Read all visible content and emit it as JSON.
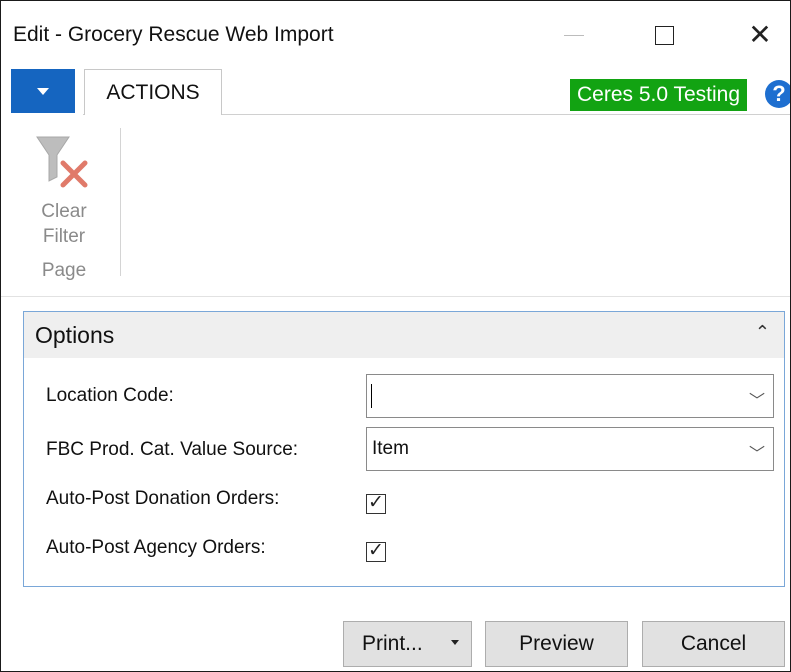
{
  "window": {
    "title": "Edit - Grocery Rescue Web Import"
  },
  "ribbon": {
    "tab_actions": "ACTIONS",
    "environment_badge": "Ceres 5.0 Testing",
    "help_glyph": "?",
    "clear_filter_line1": "Clear",
    "clear_filter_line2": "Filter",
    "group_label": "Page"
  },
  "options": {
    "title": "Options",
    "fields": {
      "location_code": {
        "label": "Location Code:",
        "value": ""
      },
      "fbc_source": {
        "label": "FBC Prod. Cat. Value Source:",
        "value": "Item"
      },
      "auto_post_donation": {
        "label": "Auto-Post Donation Orders:",
        "checked": true
      },
      "auto_post_agency": {
        "label": "Auto-Post Agency Orders:",
        "checked": true
      }
    }
  },
  "buttons": {
    "print": "Print...",
    "preview": "Preview",
    "cancel": "Cancel"
  },
  "colors": {
    "app_button": "#1565c0",
    "env_badge": "#12a312",
    "help_icon": "#1e6fd0",
    "options_border": "#7aa7d8"
  },
  "icons": [
    "chevron-down-icon",
    "clear-filter-icon",
    "help-icon",
    "checkmark-icon",
    "collapse-icon"
  ]
}
